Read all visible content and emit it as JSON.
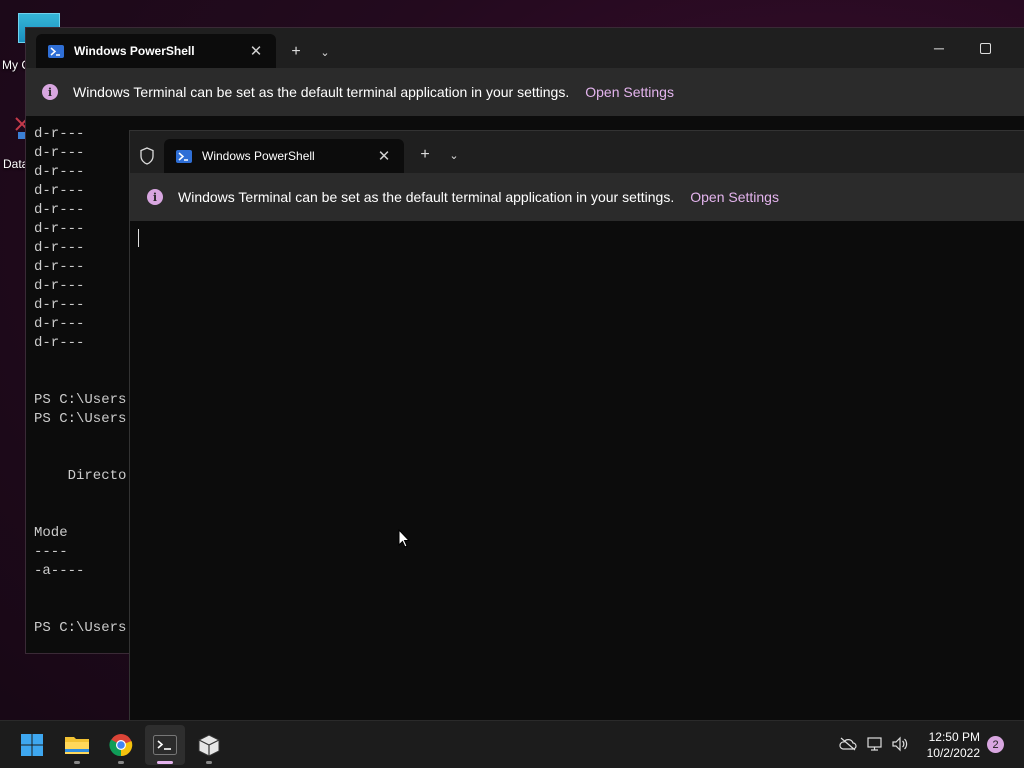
{
  "desktop": {
    "icons": [
      {
        "label": "My C"
      },
      {
        "label": "Data"
      }
    ]
  },
  "back_window": {
    "tab_title": "Windows PowerShell",
    "infobar_message": "Windows Terminal can be set as the default terminal application in your settings.",
    "infobar_link": "Open Settings",
    "console_lines": [
      "d-r---",
      "d-r---",
      "d-r---",
      "d-r---",
      "d-r---",
      "d-r---",
      "d-r---",
      "d-r---",
      "d-r---",
      "d-r---",
      "d-r---",
      "d-r---",
      "",
      "",
      "PS C:\\Users",
      "PS C:\\Users",
      "",
      "",
      "    Directo",
      "",
      "",
      "Mode",
      "----",
      "-a----",
      "",
      "",
      "PS C:\\Users"
    ]
  },
  "front_window": {
    "tab_title": "Windows PowerShell",
    "infobar_message": "Windows Terminal can be set as the default terminal application in your settings.",
    "infobar_link": "Open Settings"
  },
  "taskbar": {
    "apps": [
      {
        "name": "start",
        "icon": "windows-logo-icon"
      },
      {
        "name": "file-explorer",
        "icon": "folder-icon"
      },
      {
        "name": "chrome",
        "icon": "chrome-icon"
      },
      {
        "name": "terminal",
        "icon": "terminal-icon",
        "active": true
      },
      {
        "name": "package",
        "icon": "box-icon"
      }
    ],
    "clock_time": "12:50 PM",
    "clock_date": "10/2/2022",
    "notification_count": "2"
  },
  "colors": {
    "accent": "#e4b4ee",
    "terminal_bg": "#0c0c0c",
    "titlebar_bg": "#1f1f1f",
    "infobar_bg": "#2b2b2b"
  }
}
